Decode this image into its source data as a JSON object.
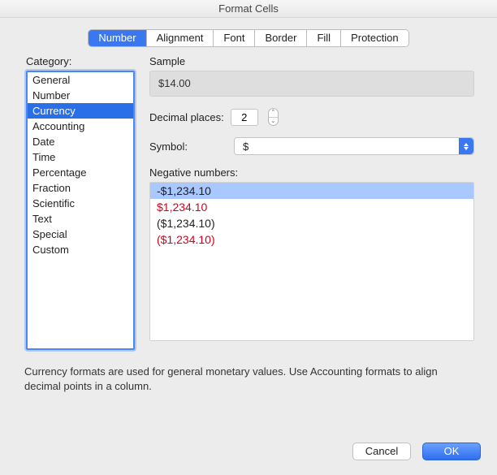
{
  "window": {
    "title": "Format Cells"
  },
  "tabs": [
    "Number",
    "Alignment",
    "Font",
    "Border",
    "Fill",
    "Protection"
  ],
  "tab_selected_index": 0,
  "category": {
    "label": "Category:",
    "items": [
      "General",
      "Number",
      "Currency",
      "Accounting",
      "Date",
      "Time",
      "Percentage",
      "Fraction",
      "Scientific",
      "Text",
      "Special",
      "Custom"
    ],
    "selected_index": 2
  },
  "sample": {
    "label": "Sample",
    "value": "$14.00"
  },
  "decimal": {
    "label": "Decimal places:",
    "value": "2"
  },
  "symbol": {
    "label": "Symbol:",
    "value": "$"
  },
  "negative": {
    "label": "Negative numbers:",
    "items": [
      {
        "text": "-$1,234.10",
        "red": false
      },
      {
        "text": "$1,234.10",
        "red": true
      },
      {
        "text": "($1,234.10)",
        "red": false
      },
      {
        "text": "($1,234.10)",
        "red": true
      }
    ],
    "selected_index": 0
  },
  "description": "Currency formats are used for general monetary values.  Use Accounting formats to align decimal points in a column.",
  "buttons": {
    "cancel": "Cancel",
    "ok": "OK"
  }
}
